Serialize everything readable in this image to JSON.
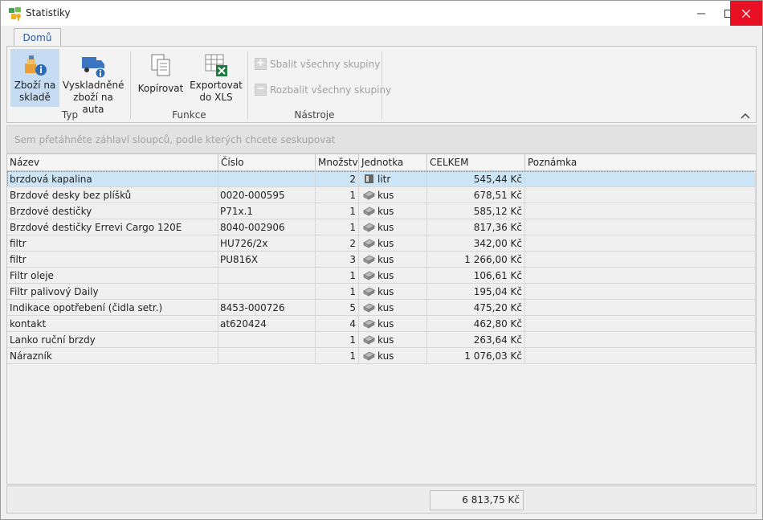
{
  "window": {
    "title": "Statistiky"
  },
  "ribbon": {
    "tab": "Domů",
    "groups": {
      "typ": {
        "label": "Typ",
        "btn_stock_line1": "Zboží na",
        "btn_stock_line2": "skladě",
        "btn_trucks_line1": "Vyskladněné",
        "btn_trucks_line2": "zboží na auta"
      },
      "funkce": {
        "label": "Funkce",
        "btn_copy": "Kopírovat",
        "btn_export_line1": "Exportovat",
        "btn_export_line2": "do XLS"
      },
      "nastroje": {
        "label": "Nástroje",
        "btn_collapse_all": "Sbalit všechny skupiny",
        "btn_expand_all": "Rozbalit všechny skupiny"
      }
    }
  },
  "group_panel": {
    "hint": "Sem přetáhněte záhlaví sloupců, podle kterých chcete seskupovat"
  },
  "grid": {
    "columns": [
      "Název",
      "Číslo",
      "Množství",
      "Jednotka",
      "CELKEM",
      "Poznámka"
    ],
    "rows": [
      {
        "name": "brzdová kapalina",
        "number": "",
        "qty": "2",
        "unit": "litr",
        "unit_icon": "canister-icon",
        "total": "545,44 Kč",
        "note": ""
      },
      {
        "name": "Brzdové desky bez plíšků",
        "number": "0020-000595",
        "qty": "1",
        "unit": "kus",
        "unit_icon": "box-icon",
        "total": "678,51 Kč",
        "note": ""
      },
      {
        "name": "Brzdové destičky",
        "number": "P71x.1",
        "qty": "1",
        "unit": "kus",
        "unit_icon": "box-icon",
        "total": "585,12 Kč",
        "note": ""
      },
      {
        "name": "Brzdové destičky Errevi Cargo 120E",
        "number": "8040-002906",
        "qty": "1",
        "unit": "kus",
        "unit_icon": "box-icon",
        "total": "817,36 Kč",
        "note": ""
      },
      {
        "name": "filtr",
        "number": "HU726/2x",
        "qty": "2",
        "unit": "kus",
        "unit_icon": "box-icon",
        "total": "342,00 Kč",
        "note": ""
      },
      {
        "name": "filtr",
        "number": "PU816X",
        "qty": "3",
        "unit": "kus",
        "unit_icon": "box-icon",
        "total": "1 266,00 Kč",
        "note": ""
      },
      {
        "name": "Filtr oleje",
        "number": "",
        "qty": "1",
        "unit": "kus",
        "unit_icon": "box-icon",
        "total": "106,61 Kč",
        "note": ""
      },
      {
        "name": "Filtr palivový Daily",
        "number": "",
        "qty": "1",
        "unit": "kus",
        "unit_icon": "box-icon",
        "total": "195,04 Kč",
        "note": ""
      },
      {
        "name": "Indikace opotřebení (čidla setr.)",
        "number": "8453-000726",
        "qty": "5",
        "unit": "kus",
        "unit_icon": "box-icon",
        "total": "475,20 Kč",
        "note": ""
      },
      {
        "name": "kontakt",
        "number": "at620424",
        "qty": "4",
        "unit": "kus",
        "unit_icon": "box-icon",
        "total": "462,80 Kč",
        "note": ""
      },
      {
        "name": "Lanko ruční brzdy",
        "number": "",
        "qty": "1",
        "unit": "kus",
        "unit_icon": "box-icon",
        "total": "263,64 Kč",
        "note": ""
      },
      {
        "name": "Nárazník",
        "number": "",
        "qty": "1",
        "unit": "kus",
        "unit_icon": "box-icon",
        "total": "1 076,03 Kč",
        "note": ""
      }
    ],
    "selected_row": 0
  },
  "footer": {
    "total": "6 813,75 Kč"
  },
  "colors": {
    "accent": "#2b579a",
    "selection": "#cde6f7",
    "close_button": "#e81123"
  }
}
